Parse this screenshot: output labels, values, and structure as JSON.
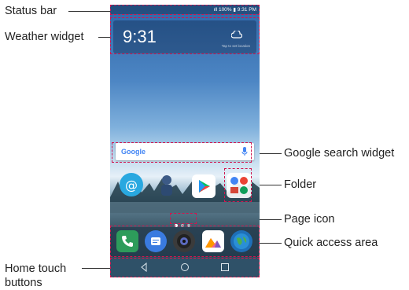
{
  "phone": {
    "status_bar": {
      "signal": "ıll",
      "battery": "100%",
      "time": "9:31 PM"
    },
    "weather": {
      "time": "9:31",
      "subtitle": "Tap to set location"
    },
    "search": {
      "brand": "Google"
    }
  },
  "labels": {
    "status_bar": "Status bar",
    "weather_widget": "Weather widget",
    "google_search_widget": "Google search widget",
    "folder": "Folder",
    "page_icon": "Page icon",
    "quick_access_area": "Quick access area",
    "home_touch_buttons_line1": "Home touch",
    "home_touch_buttons_line2": "buttons"
  },
  "colors": {
    "annotation_box": "#d1154f",
    "sky_top": "#2f67a8",
    "nav_bar": "#2f5168"
  },
  "icons": {
    "status": [
      "signal-icon",
      "battery-icon"
    ],
    "weather": "cloud-icon",
    "search": "mic-icon",
    "apps": [
      "email-app-icon",
      "person-app-icon",
      "play-store-icon",
      "folder-icon"
    ],
    "dock": [
      "phone-icon",
      "messages-icon",
      "camera-icon",
      "gallery-icon",
      "browser-icon"
    ],
    "nav": [
      "back-icon",
      "home-icon",
      "recents-icon"
    ]
  }
}
